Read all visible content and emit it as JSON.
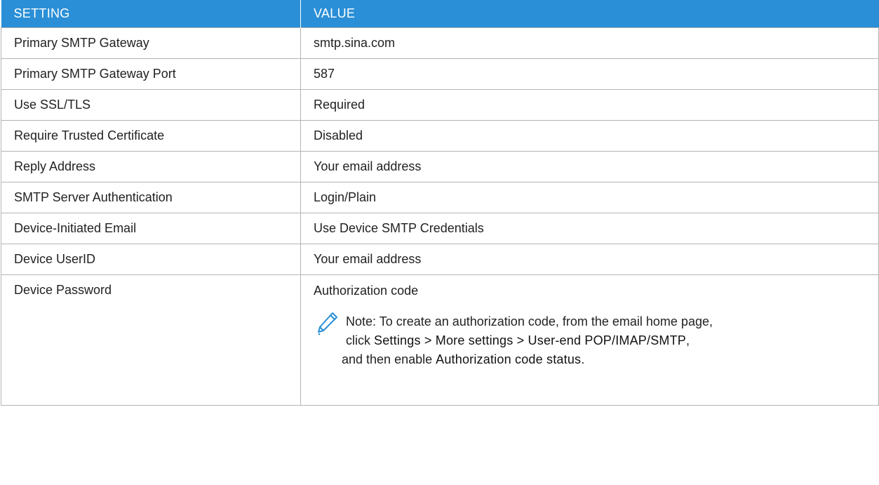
{
  "table": {
    "headers": [
      "SETTING",
      "VALUE"
    ],
    "rows": [
      {
        "setting": "Primary SMTP Gateway",
        "value": "smtp.sina.com"
      },
      {
        "setting": "Primary SMTP Gateway Port",
        "value": "587"
      },
      {
        "setting": "Use SSL/TLS",
        "value": "Required"
      },
      {
        "setting": "Require Trusted Certificate",
        "value": "Disabled"
      },
      {
        "setting": "Reply Address",
        "value": "Your email address"
      },
      {
        "setting": "SMTP Server Authentication",
        "value": "Login/Plain"
      },
      {
        "setting": "Device-Initiated Email",
        "value": "Use Device SMTP Credentials"
      },
      {
        "setting": "Device UserID",
        "value": "Your email address"
      },
      {
        "setting": "Device Password",
        "value": "Authorization code"
      }
    ]
  },
  "note": {
    "icon": "pencil-icon",
    "line1": "Note: To create an authorization code, from the email home page,",
    "line2_prefix": "click ",
    "path_settings": "Settings",
    "sep1": " > ",
    "path_more": "More settings",
    "sep2": " > ",
    "path_userend": "User-end POP/IMAP/SMTP",
    "line2_suffix": ",",
    "line3_prefix": "and then enable ",
    "enable_label": "Authorization code status",
    "line3_suffix": "."
  },
  "colors": {
    "header_bg": "#2a8fd6",
    "header_text": "#ffffff",
    "border": "#b4b4b4",
    "icon": "#2a8fd6"
  }
}
